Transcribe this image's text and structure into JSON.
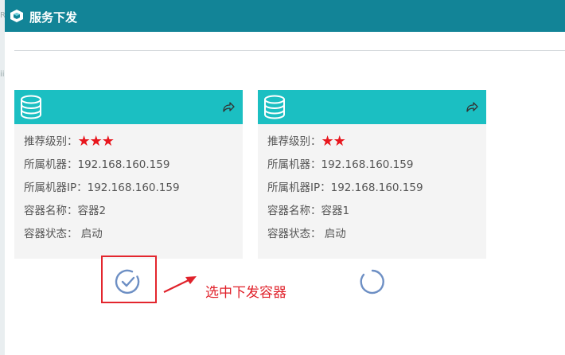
{
  "window": {
    "title": "服务下发"
  },
  "colors": {
    "titlebar": "#128497",
    "card_header": "#1bbfc2",
    "card_body": "#f4f4f4",
    "stars": "#e8161d",
    "annotation": "#e0222b"
  },
  "cards": [
    {
      "rating_label": "推荐级别：",
      "rating_stars": "★★★",
      "rating": 3,
      "machine": "所属机器：192.168.160.159",
      "machine_ip": "所属机器IP：192.168.160.159",
      "container_name": "容器名称：容器2",
      "status": "容器状态： 启动",
      "header_icon": "database-icon",
      "action_icon": "share-icon",
      "selection_state": "selected"
    },
    {
      "rating_label": "推荐级别：",
      "rating_stars": "★★",
      "rating": 2,
      "machine": "所属机器：192.168.160.159",
      "machine_ip": "所属机器IP：192.168.160.159",
      "container_name": "容器名称：容器1",
      "status": "容器状态： 启动",
      "header_icon": "database-icon",
      "action_icon": "share-icon",
      "selection_state": "unselected"
    }
  ],
  "annotation": {
    "text": "选中下发容器"
  }
}
